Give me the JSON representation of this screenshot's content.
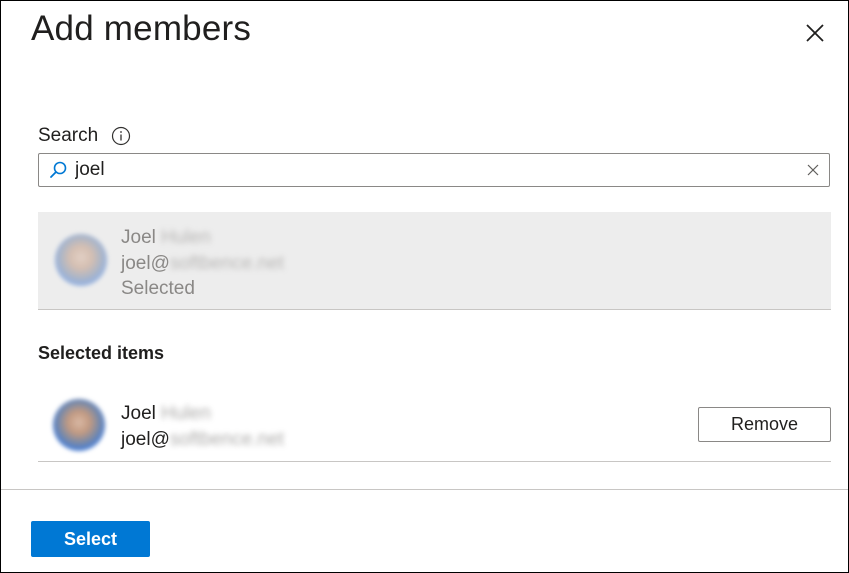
{
  "dialog": {
    "title": "Add members",
    "close_icon": "close-icon"
  },
  "search": {
    "label": "Search",
    "info_icon": "info-icon",
    "search_icon": "search-icon",
    "value": "joel",
    "clear_icon": "clear-icon"
  },
  "results": [
    {
      "first_name": "Joel",
      "last_name_redacted": "Hulen",
      "email_user": "joel@",
      "email_domain_redacted": "softbence.net",
      "status": "Selected"
    }
  ],
  "selected_items": {
    "heading": "Selected items",
    "items": [
      {
        "first_name": "Joel",
        "last_name_redacted": "Hulen",
        "email_user": "joel@",
        "email_domain_redacted": "softbence.net",
        "remove_label": "Remove"
      }
    ]
  },
  "footer": {
    "select_label": "Select"
  },
  "colors": {
    "accent": "#0078d4",
    "result_background": "#ededed",
    "border": "#8a8886"
  }
}
